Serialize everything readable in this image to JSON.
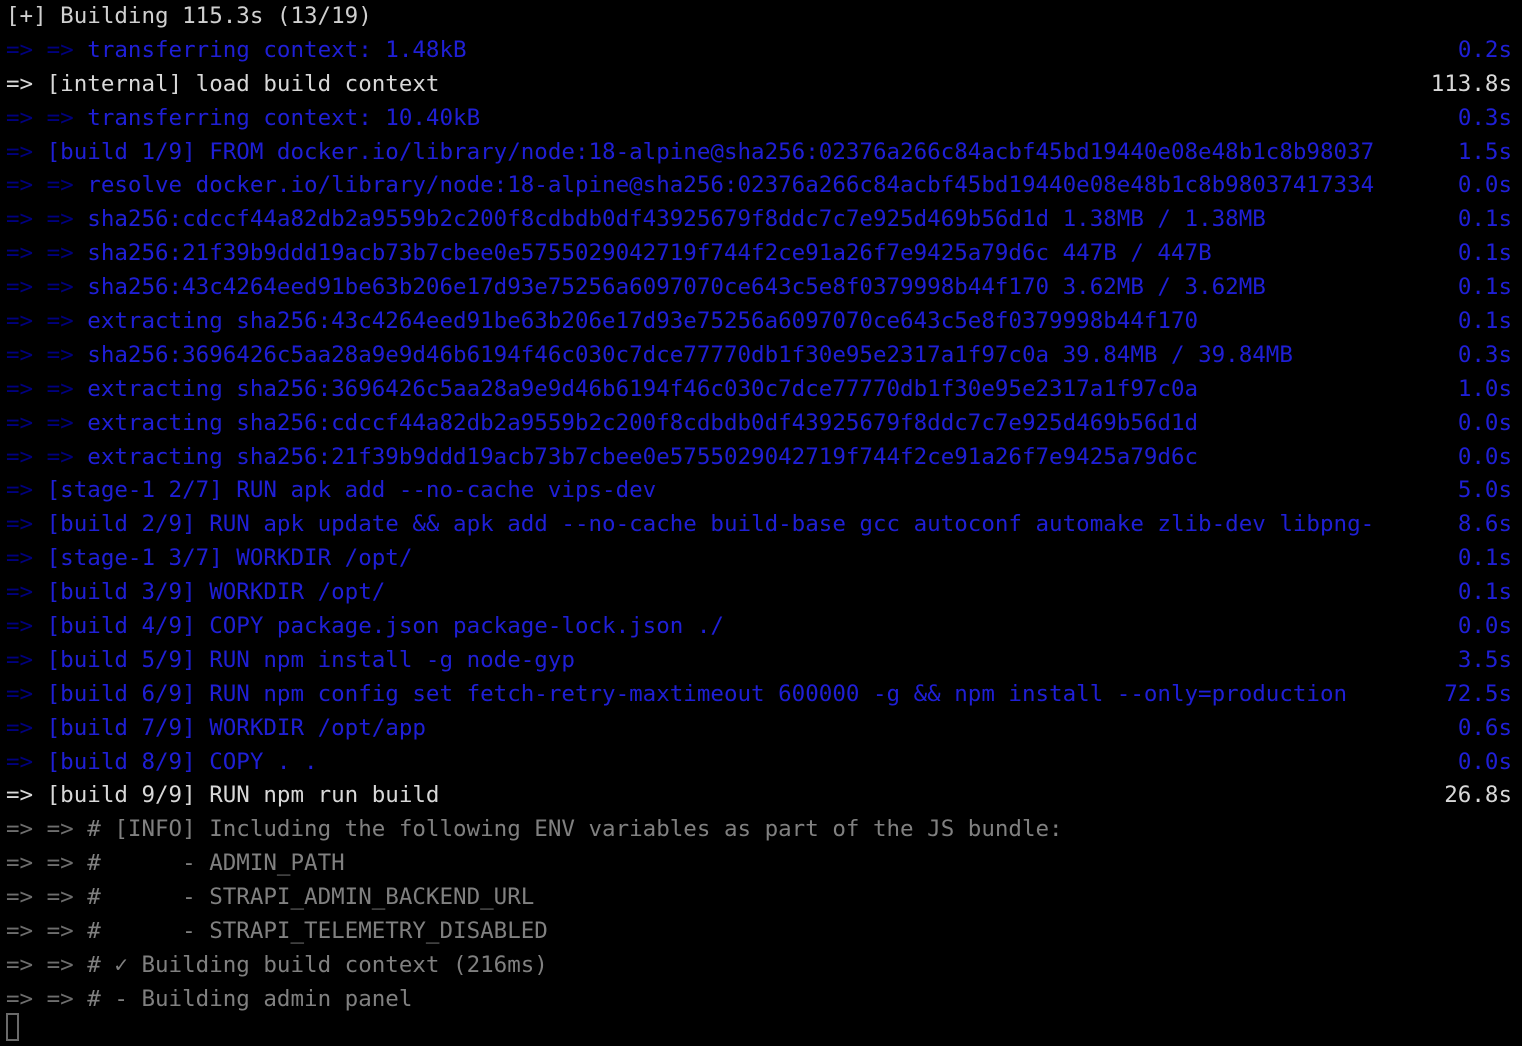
{
  "terminal": {
    "type": "docker-buildkit-progress",
    "colors": {
      "background": "#000000",
      "completed_step": "#1f1fd6",
      "arrow_prefix": "#00007e",
      "active_step": "#d8d8d8",
      "log_output": "#808080",
      "cursor_border": "#6a6a6a"
    },
    "header": {
      "text": "[+] Building 115.3s (13/19)",
      "elapsed": "115.3s",
      "steps_complete": 13,
      "steps_total": 19
    },
    "cursor": {
      "shape": "hollow-block",
      "row": 30,
      "column": 0
    },
    "lines": [
      {
        "arrow": "=> =>",
        "body": "transferring context: 1.48kB",
        "time": "0.2s",
        "state": "done"
      },
      {
        "arrow": "=>",
        "body": "[internal] load build context",
        "time": "113.8s",
        "state": "active"
      },
      {
        "arrow": "=> =>",
        "body": "transferring context: 10.40kB",
        "time": "0.3s",
        "state": "done"
      },
      {
        "arrow": "=>",
        "body": "[build 1/9] FROM docker.io/library/node:18-alpine@sha256:02376a266c84acbf45bd19440e08e48b1c8b98037",
        "time": "1.5s",
        "state": "done"
      },
      {
        "arrow": "=> =>",
        "body": "resolve docker.io/library/node:18-alpine@sha256:02376a266c84acbf45bd19440e08e48b1c8b98037417334",
        "time": "0.0s",
        "state": "done"
      },
      {
        "arrow": "=> =>",
        "body": "sha256:cdccf44a82db2a9559b2c200f8cdbdb0df43925679f8ddc7c7e925d469b56d1d 1.38MB / 1.38MB",
        "time": "0.1s",
        "state": "done"
      },
      {
        "arrow": "=> =>",
        "body": "sha256:21f39b9ddd19acb73b7cbee0e5755029042719f744f2ce91a26f7e9425a79d6c 447B / 447B",
        "time": "0.1s",
        "state": "done"
      },
      {
        "arrow": "=> =>",
        "body": "sha256:43c4264eed91be63b206e17d93e75256a6097070ce643c5e8f0379998b44f170 3.62MB / 3.62MB",
        "time": "0.1s",
        "state": "done"
      },
      {
        "arrow": "=> =>",
        "body": "extracting sha256:43c4264eed91be63b206e17d93e75256a6097070ce643c5e8f0379998b44f170",
        "time": "0.1s",
        "state": "done"
      },
      {
        "arrow": "=> =>",
        "body": "sha256:3696426c5aa28a9e9d46b6194f46c030c7dce77770db1f30e95e2317a1f97c0a 39.84MB / 39.84MB",
        "time": "0.3s",
        "state": "done"
      },
      {
        "arrow": "=> =>",
        "body": "extracting sha256:3696426c5aa28a9e9d46b6194f46c030c7dce77770db1f30e95e2317a1f97c0a",
        "time": "1.0s",
        "state": "done"
      },
      {
        "arrow": "=> =>",
        "body": "extracting sha256:cdccf44a82db2a9559b2c200f8cdbdb0df43925679f8ddc7c7e925d469b56d1d",
        "time": "0.0s",
        "state": "done"
      },
      {
        "arrow": "=> =>",
        "body": "extracting sha256:21f39b9ddd19acb73b7cbee0e5755029042719f744f2ce91a26f7e9425a79d6c",
        "time": "0.0s",
        "state": "done"
      },
      {
        "arrow": "=>",
        "body": "[stage-1 2/7] RUN apk add --no-cache vips-dev",
        "time": "5.0s",
        "state": "done"
      },
      {
        "arrow": "=>",
        "body": "[build 2/9] RUN apk update && apk add --no-cache build-base gcc autoconf automake zlib-dev libpng-",
        "time": "8.6s",
        "state": "done"
      },
      {
        "arrow": "=>",
        "body": "[stage-1 3/7] WORKDIR /opt/",
        "time": "0.1s",
        "state": "done"
      },
      {
        "arrow": "=>",
        "body": "[build 3/9] WORKDIR /opt/",
        "time": "0.1s",
        "state": "done"
      },
      {
        "arrow": "=>",
        "body": "[build 4/9] COPY package.json package-lock.json ./",
        "time": "0.0s",
        "state": "done"
      },
      {
        "arrow": "=>",
        "body": "[build 5/9] RUN npm install -g node-gyp",
        "time": "3.5s",
        "state": "done"
      },
      {
        "arrow": "=>",
        "body": "[build 6/9] RUN npm config set fetch-retry-maxtimeout 600000 -g && npm install --only=production",
        "time": "72.5s",
        "state": "done"
      },
      {
        "arrow": "=>",
        "body": "[build 7/9] WORKDIR /opt/app",
        "time": "0.6s",
        "state": "done"
      },
      {
        "arrow": "=>",
        "body": "[build 8/9] COPY . .",
        "time": "0.0s",
        "state": "done"
      },
      {
        "arrow": "=>",
        "body": "[build 9/9] RUN npm run build",
        "time": "26.8s",
        "state": "active"
      },
      {
        "arrow": "=> =>",
        "body": "# [INFO] Including the following ENV variables as part of the JS bundle:",
        "time": "",
        "state": "log"
      },
      {
        "arrow": "=> =>",
        "body": "#      - ADMIN_PATH",
        "time": "",
        "state": "log"
      },
      {
        "arrow": "=> =>",
        "body": "#      - STRAPI_ADMIN_BACKEND_URL",
        "time": "",
        "state": "log"
      },
      {
        "arrow": "=> =>",
        "body": "#      - STRAPI_TELEMETRY_DISABLED",
        "time": "",
        "state": "log"
      },
      {
        "arrow": "=> =>",
        "body": "# ✓ Building build context (216ms)",
        "time": "",
        "state": "log"
      },
      {
        "arrow": "=> =>",
        "body": "# - Building admin panel",
        "time": "",
        "state": "log"
      }
    ]
  }
}
